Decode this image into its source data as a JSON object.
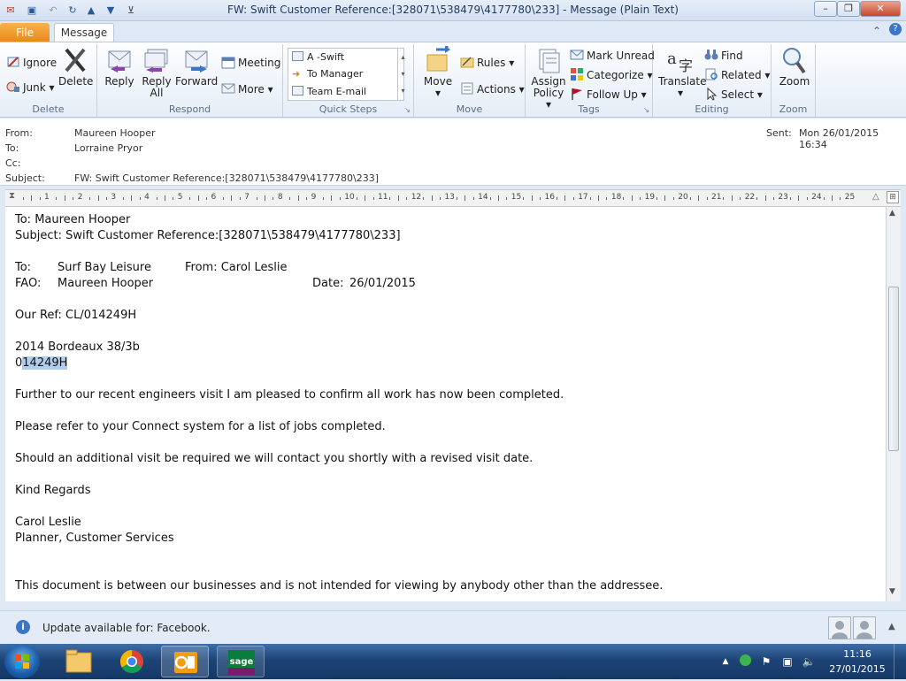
{
  "window": {
    "title": "FW: Swift Customer Reference:[328071\\538479\\4177780\\233]  -  Message (Plain Text)",
    "minimize": "–",
    "maximize": "❐",
    "close": "✕"
  },
  "tabs": {
    "file": "File",
    "message": "Message"
  },
  "ribbon": {
    "delete_group": {
      "label": "Delete",
      "ignore": "Ignore",
      "junk": "Junk",
      "delete": "Delete"
    },
    "respond_group": {
      "label": "Respond",
      "reply": "Reply",
      "reply_all_1": "Reply",
      "reply_all_2": "All",
      "forward": "Forward",
      "meeting": "Meeting",
      "more": "More"
    },
    "quick_steps": {
      "label": "Quick Steps",
      "items": [
        "A -Swift",
        "To Manager",
        "Team E-mail"
      ]
    },
    "move_group": {
      "label": "Move",
      "move": "Move",
      "rules": "Rules",
      "actions": "Actions"
    },
    "tags_group": {
      "label": "Tags",
      "assign_1": "Assign",
      "assign_2": "Policy",
      "mark_unread": "Mark Unread",
      "categorize": "Categorize",
      "follow_up": "Follow Up"
    },
    "editing_group": {
      "label": "Editing",
      "translate": "Translate",
      "find": "Find",
      "related": "Related",
      "select": "Select"
    },
    "zoom_group": {
      "label": "Zoom",
      "zoom": "Zoom"
    }
  },
  "header": {
    "from_label": "From:",
    "from_value": "Maureen Hooper",
    "to_label": "To:",
    "to_value": "Lorraine Pryor",
    "cc_label": "Cc:",
    "subject_label": "Subject:",
    "subject_value": "FW: Swift Customer Reference:[328071\\538479\\4177780\\233]",
    "sent_label": "Sent:",
    "sent_value": "Mon 26/01/2015 16:34"
  },
  "ruler_numbers": [
    "1",
    "2",
    "3",
    "4",
    "5",
    "6",
    "7",
    "8",
    "9",
    "10",
    "11",
    "12",
    "13",
    "14",
    "15",
    "16",
    "17",
    "18",
    "19",
    "20",
    "21",
    "22",
    "23",
    "24",
    "25"
  ],
  "body": {
    "to_line": "To: Maureen Hooper",
    "subject_line": "Subject: Swift Customer Reference:[328071\\538479\\4177780\\233]",
    "to2_label": "To:",
    "to2_value": "Surf Bay Leisure",
    "from2": "From: Carol Leslie",
    "fao_label": "FAO:",
    "fao_value": "Maureen Hooper",
    "date_label": "Date:",
    "date_value": "26/01/2015",
    "our_ref": "Our Ref: CL/014249H",
    "product": "2014 Bordeaux 38/3b",
    "ref_prefix": "0",
    "ref_selected": "14249H",
    "p1": "Further to our recent engineers visit I am pleased to confirm all work has now been completed.",
    "p2": "Please refer to your Connect system for a list of jobs completed.",
    "p3": "Should an additional visit be required we will contact you shortly with a revised visit date.",
    "regards": "Kind Regards",
    "sig_name": "Carol Leslie",
    "sig_title": "Planner, Customer Services",
    "disclaimer": "This document is between our businesses and is not intended for viewing by anybody other than the addressee."
  },
  "status": {
    "update_text": "Update available for: Facebook."
  },
  "taskbar": {
    "time": "11:16",
    "date": "27/01/2015"
  },
  "colors": {
    "file_tab": "#e8871a",
    "selection": "#b3cdef",
    "taskbar": "#1d4477"
  }
}
